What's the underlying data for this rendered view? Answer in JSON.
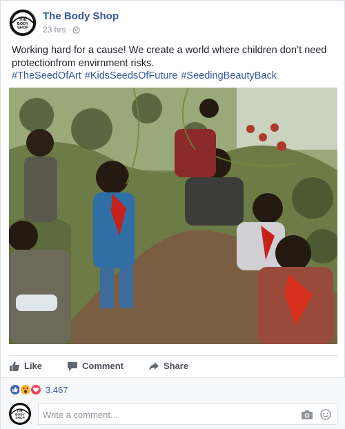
{
  "post": {
    "page_name": "The Body Shop",
    "time": "23 hrs",
    "separator": "·",
    "text": "Working hard for a cause! We create a world where children don’t need protectionfrom envirnment risks.",
    "hashtags": [
      "#TheSeedOfArt",
      "#KidsSeedsOfFuture",
      "#SeedingBeautyBack"
    ]
  },
  "logo": {
    "line1": "THE",
    "line2": "BODY",
    "line3": "SHOP"
  },
  "actions": {
    "like": "Like",
    "comment": "Comment",
    "share": "Share"
  },
  "reactions": {
    "count": "3.467",
    "types": [
      "like-icon",
      "wow-icon",
      "love-icon"
    ]
  },
  "comment": {
    "placeholder": "Write a comment..."
  },
  "colors": {
    "link": "#365899",
    "muted": "#90949c",
    "like": "#4267b2",
    "love": "#f33e58",
    "wow": "#f7b125"
  }
}
